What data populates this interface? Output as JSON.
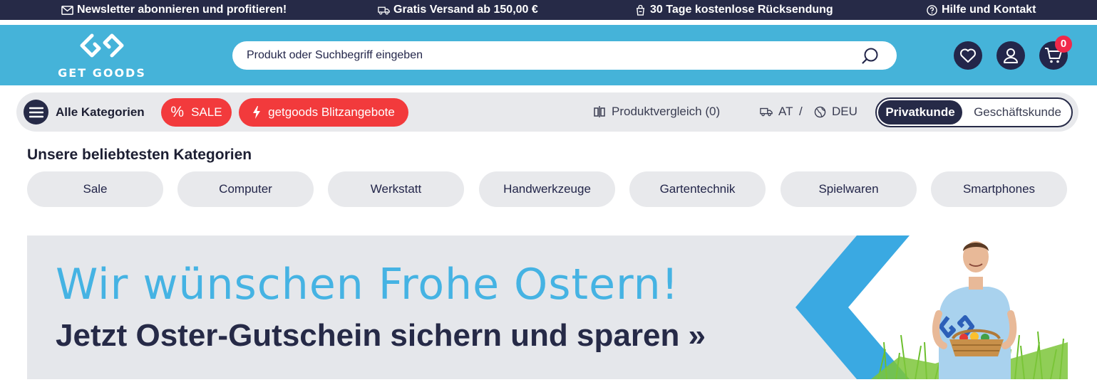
{
  "topbar": {
    "newsletter": "Newsletter abonnieren und profitieren!",
    "shipping": "Gratis Versand ab 150,00 €",
    "returns": "30 Tage kostenlose Rücksendung",
    "help": "Hilfe und Kontakt"
  },
  "header": {
    "logo_text": "GET GOODS",
    "search_placeholder": "Produkt oder Suchbegriff eingeben",
    "cart_count": "0",
    "icons": [
      "heart-icon",
      "user-icon",
      "cart-icon",
      "search-icon"
    ]
  },
  "nav": {
    "all_categories": "Alle Kategorien",
    "sale": "SALE",
    "flash_deals": "getgoods Blitzangebote",
    "compare": "Produktvergleich (0)",
    "country": "AT",
    "separator": "/",
    "language": "DEU",
    "customer_private": "Privatkunde",
    "customer_business": "Geschäftskunde"
  },
  "categories": {
    "heading": "Unsere beliebtesten Kategorien",
    "items": [
      "Sale",
      "Computer",
      "Werkstatt",
      "Handwerkzeuge",
      "Gartentechnik",
      "Spielwaren",
      "Smartphones"
    ]
  },
  "banner": {
    "headline": "Wir wünschen Frohe Ostern!",
    "subline": "Jetzt Oster-Gutschein sichern und sparen »"
  },
  "colors": {
    "dark": "#262a47",
    "brand_blue": "#45b3d9",
    "sale_red": "#f23a3c",
    "badge_red": "#f0294a",
    "pill_gray": "#e8e9ec"
  }
}
